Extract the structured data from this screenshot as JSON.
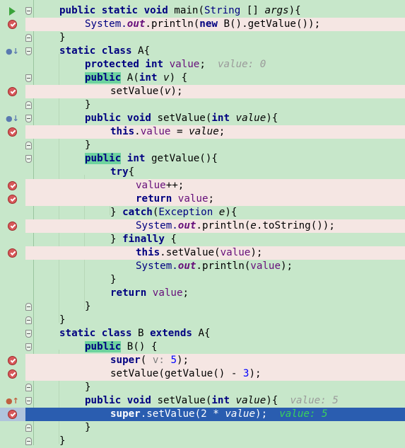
{
  "colors": {
    "editor_bg": "#c7e7ca",
    "breakpoint_line_bg": "#f5e6e3",
    "execution_line_bg": "#2a5db0",
    "keyword": "#000080",
    "field": "#660e7a",
    "number": "#0000ff",
    "inline_value": "#9a9a9a",
    "exec_inline_value": "#3bd35a",
    "identifier_highlight": "#6ed39e"
  },
  "code": {
    "l1": {
      "a": "public static void ",
      "b": "main",
      "c": "(",
      "d": "String",
      "e": " [] ",
      "f": "args",
      "g": "){"
    },
    "l2": {
      "a": "System.",
      "b": "out",
      "c": ".println(",
      "d": "new ",
      "e": "B().getValue());"
    },
    "l3": {
      "a": "}"
    },
    "l4": {
      "a": "static class ",
      "b": "A{"
    },
    "l5": {
      "a": "protected int ",
      "b": "value",
      "c": ";",
      "d": "value: 0"
    },
    "l6": {
      "a": "public",
      "b": " A(",
      "c": "int ",
      "d": "v",
      "e": ") {"
    },
    "l7": {
      "a": "setValue(",
      "b": "v",
      "c": ");"
    },
    "l8": {
      "a": "}"
    },
    "l9": {
      "a": "public void ",
      "b": "setValue(",
      "c": "int ",
      "d": "value",
      "e": "){"
    },
    "l10": {
      "a": "this",
      "b": ".",
      "c": "value",
      "d": " = ",
      "e": "value",
      "f": ";"
    },
    "l11": {
      "a": "}"
    },
    "l12": {
      "a": "public",
      "b": " int ",
      "c": "getValue(){"
    },
    "l13": {
      "a": "try",
      "b": "{"
    },
    "l14": {
      "a": "value",
      "b": "++;"
    },
    "l15": {
      "a": "return ",
      "b": "value",
      "c": ";"
    },
    "l16": {
      "a": "} ",
      "b": "catch",
      "c": "(",
      "d": "Exception ",
      "e": "e",
      "f": "){"
    },
    "l17": {
      "a": "System.",
      "b": "out",
      "c": ".println(",
      "d": "e",
      "e": ".toString());"
    },
    "l18": {
      "a": "} ",
      "b": "finally",
      "c": " {"
    },
    "l19": {
      "a": "this",
      "b": ".setValue(",
      "c": "value",
      "d": ");"
    },
    "l20": {
      "a": "System.",
      "b": "out",
      "c": ".println(",
      "d": "value",
      "e": ");"
    },
    "l21": {
      "a": "}"
    },
    "l22": {
      "a": "return ",
      "b": "value",
      "c": ";"
    },
    "l23": {
      "a": "}"
    },
    "l24": {
      "a": "}"
    },
    "l25": {
      "a": "static class ",
      "b": "B ",
      "c": "extends ",
      "d": "A{"
    },
    "l26": {
      "a": "public",
      "b": " B() {"
    },
    "l27": {
      "a": "super",
      "b": "( ",
      "c": "v: ",
      "d": "5",
      "e": ");"
    },
    "l28": {
      "a": "setValue(getValue() - ",
      "b": "3",
      "c": ");"
    },
    "l29": {
      "a": "}"
    },
    "l30": {
      "a": "public void ",
      "b": "setValue(",
      "c": "int ",
      "d": "value",
      "e": "){",
      "f": "value: 5"
    },
    "l31": {
      "a": "super",
      "b": ".setValue(",
      "c": "2",
      "d": " * ",
      "e": "value",
      "f": ");",
      "g": "value: 5"
    },
    "l32": {
      "a": "}"
    },
    "l33": {
      "a": "}"
    }
  }
}
